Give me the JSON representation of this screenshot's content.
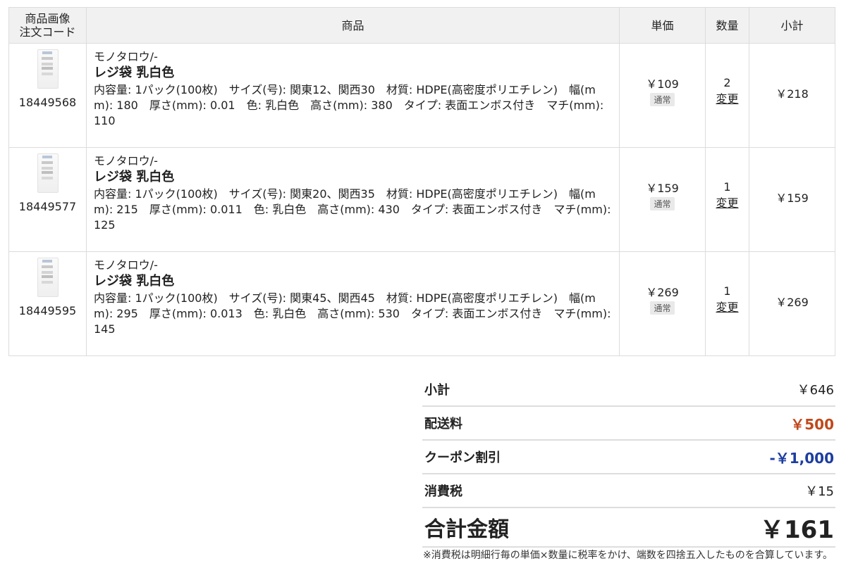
{
  "table": {
    "headers": {
      "image_line1": "商品画像",
      "image_line2": "注文コード",
      "product": "商品",
      "unit_price": "単価",
      "quantity": "数量",
      "subtotal": "小計"
    },
    "rows": [
      {
        "code": "18449568",
        "maker": "モノタロウ/-",
        "name": "レジ袋 乳白色",
        "spec": "内容量: 1パック(100枚)　サイズ(号): 関東12、関西30　材質: HDPE(高密度ポリエチレン)　幅(mm): 180　厚さ(mm): 0.01　色: 乳白色　高さ(mm): 380　タイプ: 表面エンボス付き　マチ(mm): 110",
        "price": "￥109",
        "price_tag": "通常",
        "qty": "2",
        "change": "変更",
        "subtotal": "￥218"
      },
      {
        "code": "18449577",
        "maker": "モノタロウ/-",
        "name": "レジ袋 乳白色",
        "spec": "内容量: 1パック(100枚)　サイズ(号): 関東20、関西35　材質: HDPE(高密度ポリエチレン)　幅(mm): 215　厚さ(mm): 0.011　色: 乳白色　高さ(mm): 430　タイプ: 表面エンボス付き　マチ(mm): 125",
        "price": "￥159",
        "price_tag": "通常",
        "qty": "1",
        "change": "変更",
        "subtotal": "￥159"
      },
      {
        "code": "18449595",
        "maker": "モノタロウ/-",
        "name": "レジ袋 乳白色",
        "spec": "内容量: 1パック(100枚)　サイズ(号): 関東45、関西45　材質: HDPE(高密度ポリエチレン)　幅(mm): 295　厚さ(mm): 0.013　色: 乳白色　高さ(mm): 530　タイプ: 表面エンボス付き　マチ(mm): 145",
        "price": "￥269",
        "price_tag": "通常",
        "qty": "1",
        "change": "変更",
        "subtotal": "￥269"
      }
    ]
  },
  "summary": {
    "subtotal_label": "小計",
    "subtotal_value": "￥646",
    "shipping_label": "配送料",
    "shipping_value": "￥500",
    "coupon_label": "クーポン割引",
    "coupon_value": "-￥1,000",
    "tax_label": "消費税",
    "tax_value": "￥15",
    "total_label": "合計金額",
    "total_value": "￥161",
    "note": "※消費税は明細行毎の単価×数量に税率をかけ、端数を四捨五入したものを合算しています。"
  },
  "colors": {
    "shipping": "#c0491b",
    "coupon": "#1d3ea0",
    "header_bg": "#f1f1f1"
  }
}
